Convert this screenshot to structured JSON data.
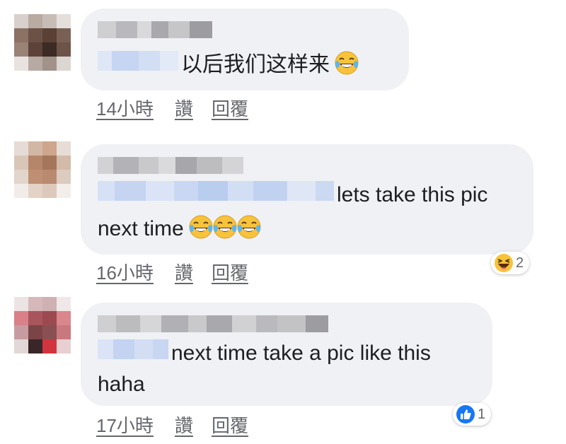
{
  "comments": [
    {
      "text": "以后我们这样来",
      "emoji_count": 1,
      "emoji": "laughing-tears-emoji",
      "time": "14小時",
      "like_label": "讚",
      "reply_label": "回覆"
    },
    {
      "text_line1": "lets take this pic",
      "text_line2": "next time",
      "emoji_count": 3,
      "emoji": "laughing-tears-emoji",
      "time": "16小時",
      "like_label": "讚",
      "reply_label": "回覆",
      "reaction": {
        "icon": "haha-reaction-icon",
        "count": "2"
      }
    },
    {
      "text_line1": "next time take a pic like this",
      "text_line2": "haha",
      "time": "17小時",
      "like_label": "讚",
      "reply_label": "回覆",
      "reaction": {
        "icon": "like-reaction-icon",
        "count": "1"
      }
    }
  ],
  "colors": {
    "bubble": "#eff1f4",
    "text": "#1c1e21",
    "meta": "#65676b",
    "like_blue": "#1877f2",
    "mention_blur": "#cfdcf5"
  }
}
